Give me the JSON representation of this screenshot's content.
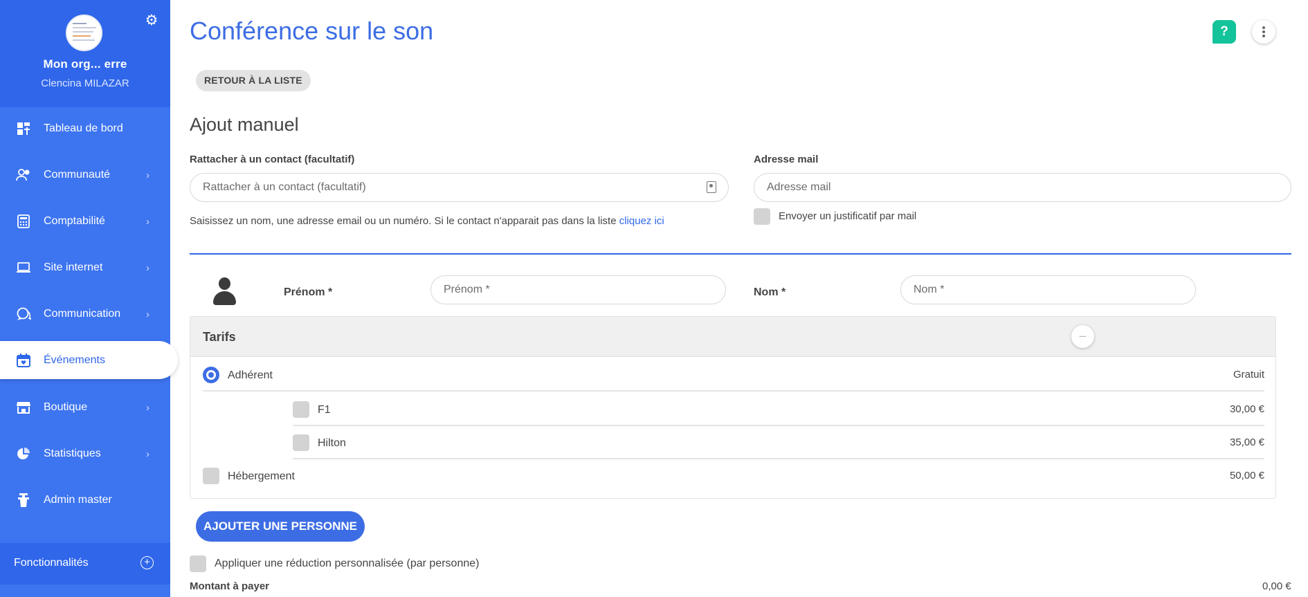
{
  "sidebar": {
    "org_name": "Mon org... erre",
    "user_name": "Clencina MILAZAR",
    "items": [
      {
        "label": "Tableau de bord",
        "icon": "dashboard-icon",
        "chevron": false
      },
      {
        "label": "Communauté",
        "icon": "users-icon",
        "chevron": true
      },
      {
        "label": "Comptabilité",
        "icon": "calculator-icon",
        "chevron": true
      },
      {
        "label": "Site internet",
        "icon": "laptop-icon",
        "chevron": true
      },
      {
        "label": "Communication",
        "icon": "chat-icon",
        "chevron": true
      },
      {
        "label": "Événements",
        "icon": "calendar-icon",
        "chevron": false,
        "active": true
      },
      {
        "label": "Boutique",
        "icon": "store-icon",
        "chevron": true
      },
      {
        "label": "Statistiques",
        "icon": "pie-chart-icon",
        "chevron": true
      },
      {
        "label": "Admin master",
        "icon": "admin-icon",
        "chevron": false
      }
    ],
    "footer_label": "Fonctionnalités"
  },
  "header": {
    "title": "Conférence sur le son",
    "help_label": "?"
  },
  "back_button": "RETOUR À LA LISTE",
  "form": {
    "section_title": "Ajout manuel",
    "contact_label": "Rattacher à un contact (facultatif)",
    "contact_placeholder": "Rattacher à un contact (facultatif)",
    "contact_help": "Saisissez un nom, une adresse email ou un numéro. Si le contact n'apparait pas dans la liste ",
    "contact_help_link": "cliquez ici",
    "email_label": "Adresse mail",
    "email_placeholder": "Adresse mail",
    "send_receipt_label": "Envoyer un justificatif par mail",
    "firstname_label": "Prénom *",
    "firstname_placeholder": "Prénom *",
    "lastname_label": "Nom *",
    "lastname_placeholder": "Nom *"
  },
  "tarifs": {
    "title": "Tarifs",
    "rows": [
      {
        "label": "Adhérent",
        "price": "Gratuit",
        "selected": true
      },
      {
        "label": "F1",
        "price": "30,00 €"
      },
      {
        "label": "Hilton",
        "price": "35,00 €"
      },
      {
        "label": "Hébergement",
        "price": "50,00 €"
      }
    ]
  },
  "add_person_button": "AJOUTER UNE PERSONNE",
  "discount_label": "Appliquer une réduction personnalisée (par personne)",
  "amount": {
    "label": "Montant à payer",
    "value": "0,00 €"
  },
  "colors": {
    "primary": "#3d6de4",
    "sidebar": "#3d74f0",
    "help": "#13c39a"
  }
}
